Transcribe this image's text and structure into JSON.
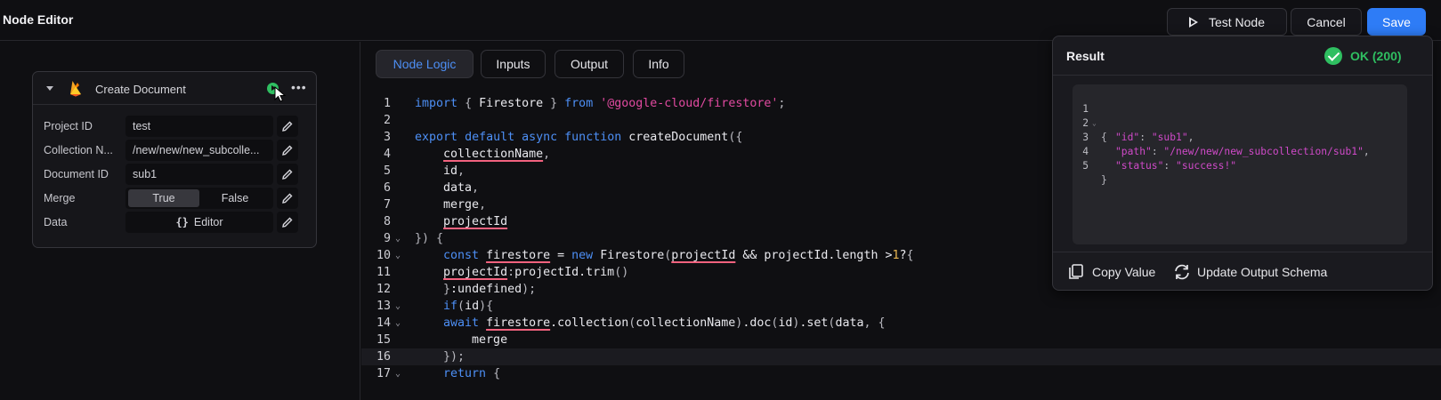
{
  "header": {
    "title": "Node Editor",
    "test_label": "Test Node",
    "cancel_label": "Cancel",
    "save_label": "Save",
    "accent": "#2e7cf6"
  },
  "node": {
    "title": "Create Document",
    "icon": "firebase-icon",
    "fields": [
      {
        "label": "Project ID",
        "value": "test"
      },
      {
        "label": "Collection N...",
        "value": "/new/new/new_subcolle..."
      },
      {
        "label": "Document ID",
        "value": "sub1"
      },
      {
        "label": "Merge",
        "options": [
          "True",
          "False"
        ],
        "selected": "True"
      },
      {
        "label": "Data",
        "button": "Editor",
        "button_glyph": "{}"
      }
    ]
  },
  "tabs": [
    "Node Logic",
    "Inputs",
    "Output",
    "Info"
  ],
  "active_tab": "Node Logic",
  "code": {
    "highlighted_line": 16,
    "lines": [
      {
        "n": "1",
        "fold": false
      },
      {
        "n": "2",
        "fold": false
      },
      {
        "n": "3",
        "fold": false
      },
      {
        "n": "4",
        "fold": false
      },
      {
        "n": "5",
        "fold": false
      },
      {
        "n": "6",
        "fold": false
      },
      {
        "n": "7",
        "fold": false
      },
      {
        "n": "8",
        "fold": false
      },
      {
        "n": "9",
        "fold": true
      },
      {
        "n": "10",
        "fold": true
      },
      {
        "n": "11",
        "fold": false
      },
      {
        "n": "12",
        "fold": false
      },
      {
        "n": "13",
        "fold": true
      },
      {
        "n": "14",
        "fold": true
      },
      {
        "n": "15",
        "fold": false
      },
      {
        "n": "16",
        "fold": false
      },
      {
        "n": "17",
        "fold": true
      }
    ]
  },
  "result": {
    "title": "Result",
    "status": "OK (200)",
    "status_color": "#2fbf61",
    "json_lines": [
      {
        "n": "1",
        "fold": true,
        "text": "{"
      },
      {
        "n": "2",
        "key": "\"id\"",
        "val": "\"sub1\"",
        "comma": true
      },
      {
        "n": "3",
        "key": "\"path\"",
        "val": "\"/new/new/new_subcollection/sub1\"",
        "comma": true
      },
      {
        "n": "4",
        "key": "\"status\"",
        "val": "\"success!\"",
        "comma": false
      },
      {
        "n": "5",
        "text": "}"
      }
    ],
    "copy_label": "Copy Value",
    "update_label": "Update Output Schema"
  }
}
